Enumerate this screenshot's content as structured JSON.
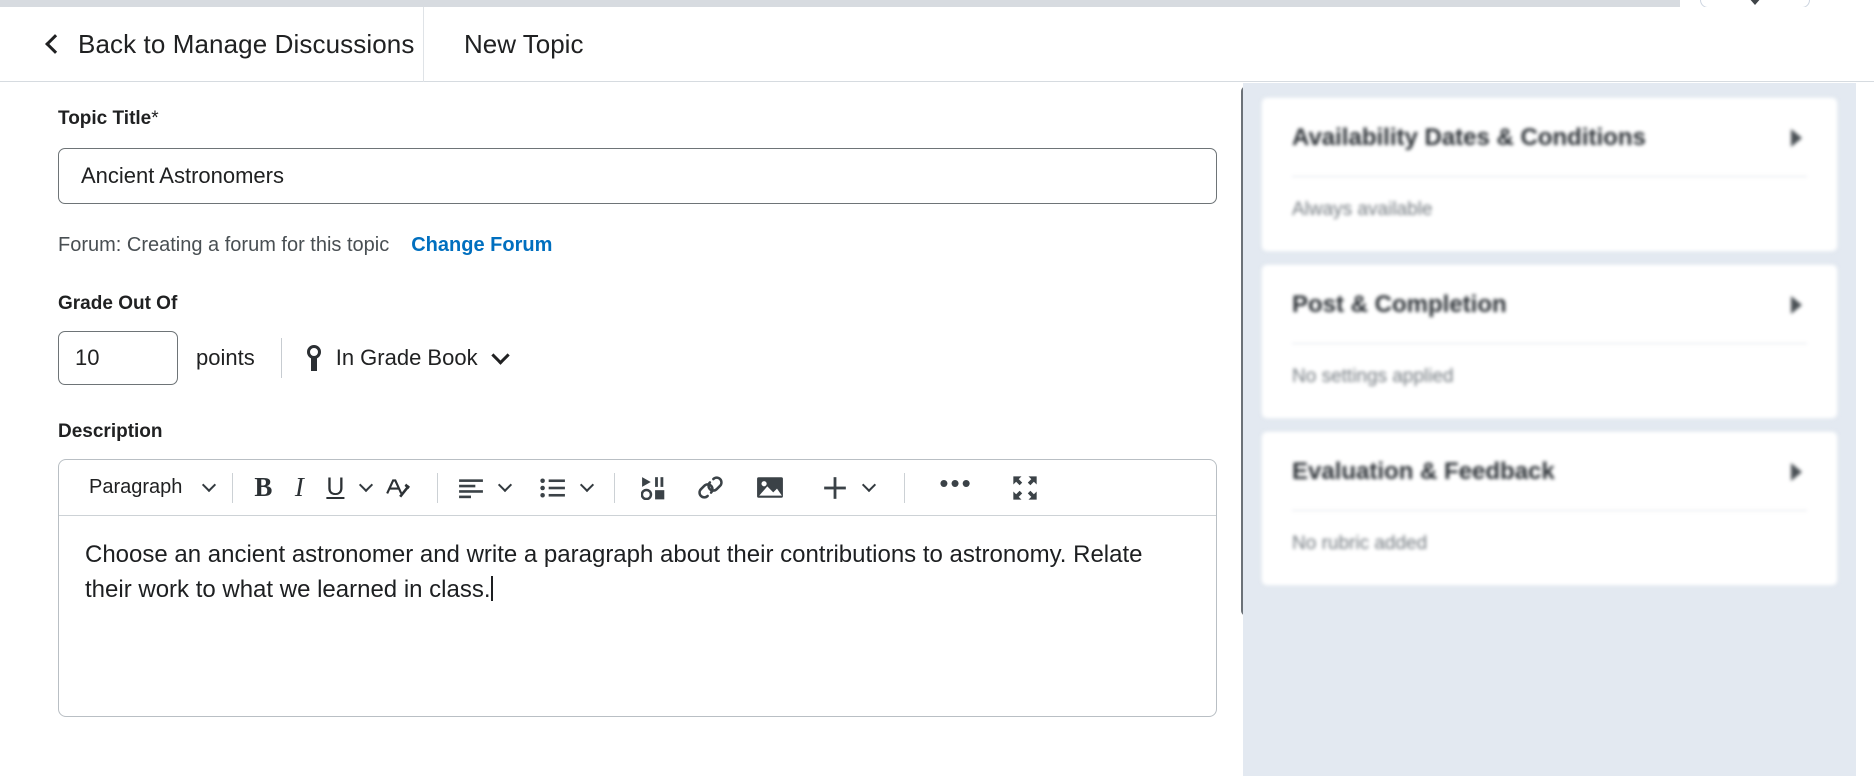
{
  "header": {
    "back_label": "Back to Manage Discussions",
    "back_icon": "chevron-left-icon",
    "title": "New Topic"
  },
  "form": {
    "topic_title": {
      "label": "Topic Title",
      "required_marker": "*",
      "value": "Ancient Astronomers",
      "placeholder": ""
    },
    "forum": {
      "text": "Forum: Creating a forum for this topic",
      "change_link": "Change Forum",
      "link_color": "#006fbf"
    },
    "grade": {
      "label": "Grade Out Of",
      "value": "10",
      "unit": "points",
      "gradebook_label": "In Grade Book",
      "gradebook_icon": "ribbon-award-icon",
      "gradebook_chevron": "chevron-down-icon"
    },
    "description": {
      "label": "Description",
      "body_text": "Choose an ancient astronomer and write a paragraph about their contributions to astronomy. Relate their work to what we learned in class."
    }
  },
  "editor_toolbar": {
    "paragraph_style": "Paragraph",
    "buttons": [
      {
        "name": "bold-button",
        "glyph": "B"
      },
      {
        "name": "italic-button",
        "glyph": "I"
      },
      {
        "name": "underline-button",
        "glyph": "U"
      },
      {
        "name": "format-painter-button",
        "glyph": "A"
      }
    ],
    "icons": [
      "align-left-icon",
      "bulleted-list-icon",
      "insert-media-icon",
      "insert-link-icon",
      "insert-image-icon",
      "insert-more-plus-icon",
      "more-options-icon",
      "fullscreen-icon"
    ],
    "overflow_label": "•••"
  },
  "sidebar": {
    "panels": [
      {
        "title": "Availability Dates & Conditions",
        "summary": "Always available",
        "expand_icon": "expand-triangle-icon"
      },
      {
        "title": "Post & Completion",
        "summary": "No settings applied",
        "expand_icon": "expand-triangle-icon"
      },
      {
        "title": "Evaluation & Feedback",
        "summary": "No rubric added",
        "expand_icon": "expand-triangle-icon"
      }
    ]
  },
  "scrollbar": {
    "name": "main-vertical-scrollbar"
  }
}
